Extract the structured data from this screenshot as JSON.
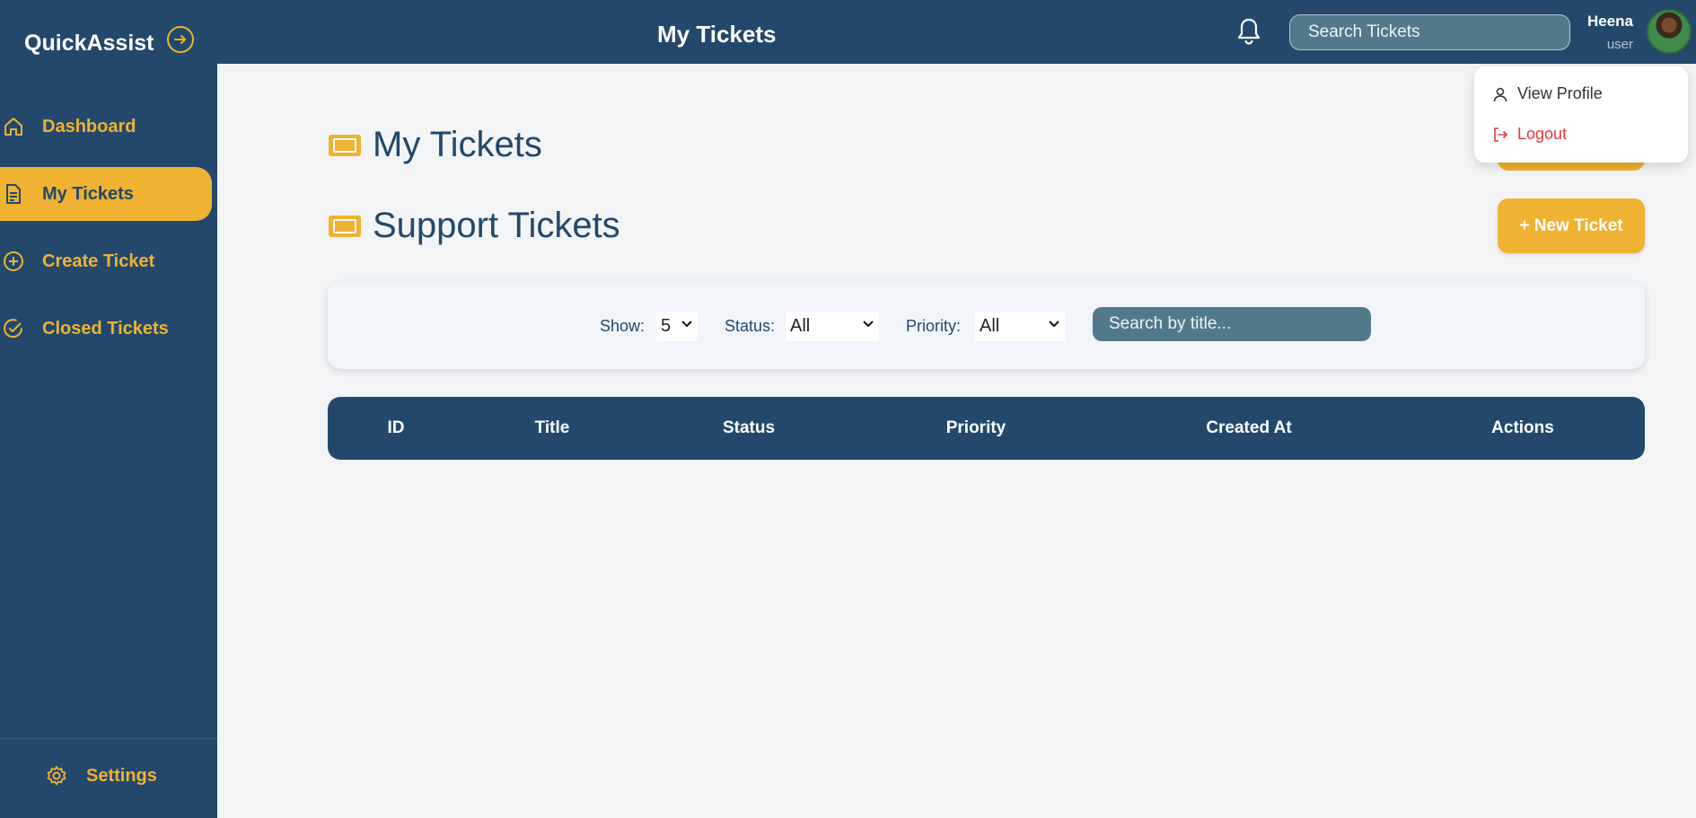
{
  "app": {
    "brand": "QuickAssist"
  },
  "header": {
    "title": "My Tickets",
    "search_placeholder": "Search Tickets",
    "user": {
      "name": "Heena",
      "role": "user"
    }
  },
  "sidebar": {
    "items": [
      {
        "label": "Dashboard",
        "icon": "home-icon",
        "active": false
      },
      {
        "label": "My Tickets",
        "icon": "document-icon",
        "active": true
      },
      {
        "label": "Create Ticket",
        "icon": "plus-circle-icon",
        "active": false
      },
      {
        "label": "Closed Tickets",
        "icon": "check-circle-icon",
        "active": false
      }
    ],
    "settings_label": "Settings"
  },
  "main": {
    "title": "My Tickets",
    "section_title": "Support Tickets",
    "new_ticket_label": "+ New Ticket",
    "filters": {
      "show_label": "Show:",
      "show_value": "5",
      "status_label": "Status:",
      "status_value": "All",
      "priority_label": "Priority:",
      "priority_value": "All",
      "search_placeholder": "Search by title..."
    },
    "table": {
      "columns": [
        "ID",
        "Title",
        "Status",
        "Priority",
        "Created At",
        "Actions"
      ],
      "rows": []
    }
  },
  "user_menu": {
    "items": [
      {
        "label": "View Profile",
        "icon": "user-icon"
      },
      {
        "label": "Logout",
        "icon": "logout-icon"
      }
    ]
  },
  "colors": {
    "primary": "#23486b",
    "accent": "#f0b232",
    "background": "#f3f4f6",
    "search_bg": "#527989",
    "danger": "#e53935"
  }
}
